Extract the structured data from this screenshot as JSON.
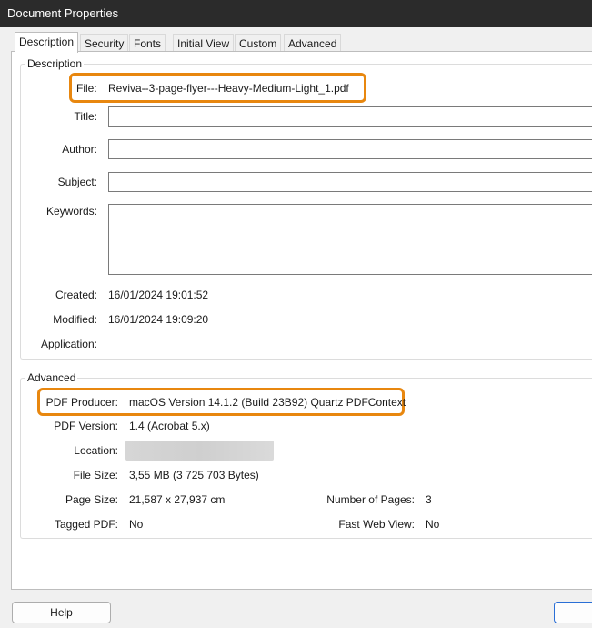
{
  "window": {
    "title": "Document Properties"
  },
  "tabs": [
    {
      "label": "Description",
      "active": true
    },
    {
      "label": "Security"
    },
    {
      "label": "Fonts"
    },
    {
      "label": "Initial View"
    },
    {
      "label": "Custom"
    },
    {
      "label": "Advanced"
    }
  ],
  "description": {
    "group_title": "Description",
    "file_label": "File:",
    "file_value": "Reviva--3-page-flyer---Heavy-Medium-Light_1.pdf",
    "title_label": "Title:",
    "title_value": "",
    "author_label": "Author:",
    "author_value": "",
    "subject_label": "Subject:",
    "subject_value": "",
    "keywords_label": "Keywords:",
    "keywords_value": "",
    "created_label": "Created:",
    "created_value": "16/01/2024 19:01:52",
    "modified_label": "Modified:",
    "modified_value": "16/01/2024 19:09:20",
    "application_label": "Application:",
    "application_value": ""
  },
  "advanced": {
    "group_title": "Advanced",
    "producer_label": "PDF Producer:",
    "producer_value": "macOS Version 14.1.2 (Build 23B92) Quartz PDFContext",
    "version_label": "PDF Version:",
    "version_value": "1.4 (Acrobat 5.x)",
    "location_label": "Location:",
    "filesize_label": "File Size:",
    "filesize_value": "3,55 MB (3 725 703 Bytes)",
    "pagesize_label": "Page Size:",
    "pagesize_value": "21,587 x 27,937 cm",
    "numpages_label": "Number of Pages:",
    "numpages_value": "3",
    "tagged_label": "Tagged PDF:",
    "tagged_value": "No",
    "fastweb_label": "Fast Web View:",
    "fastweb_value": "No"
  },
  "buttons": {
    "help_label": "Help",
    "ok_label": ""
  },
  "colors": {
    "highlight": "#e8870f",
    "titlebar": "#2b2b2b"
  }
}
